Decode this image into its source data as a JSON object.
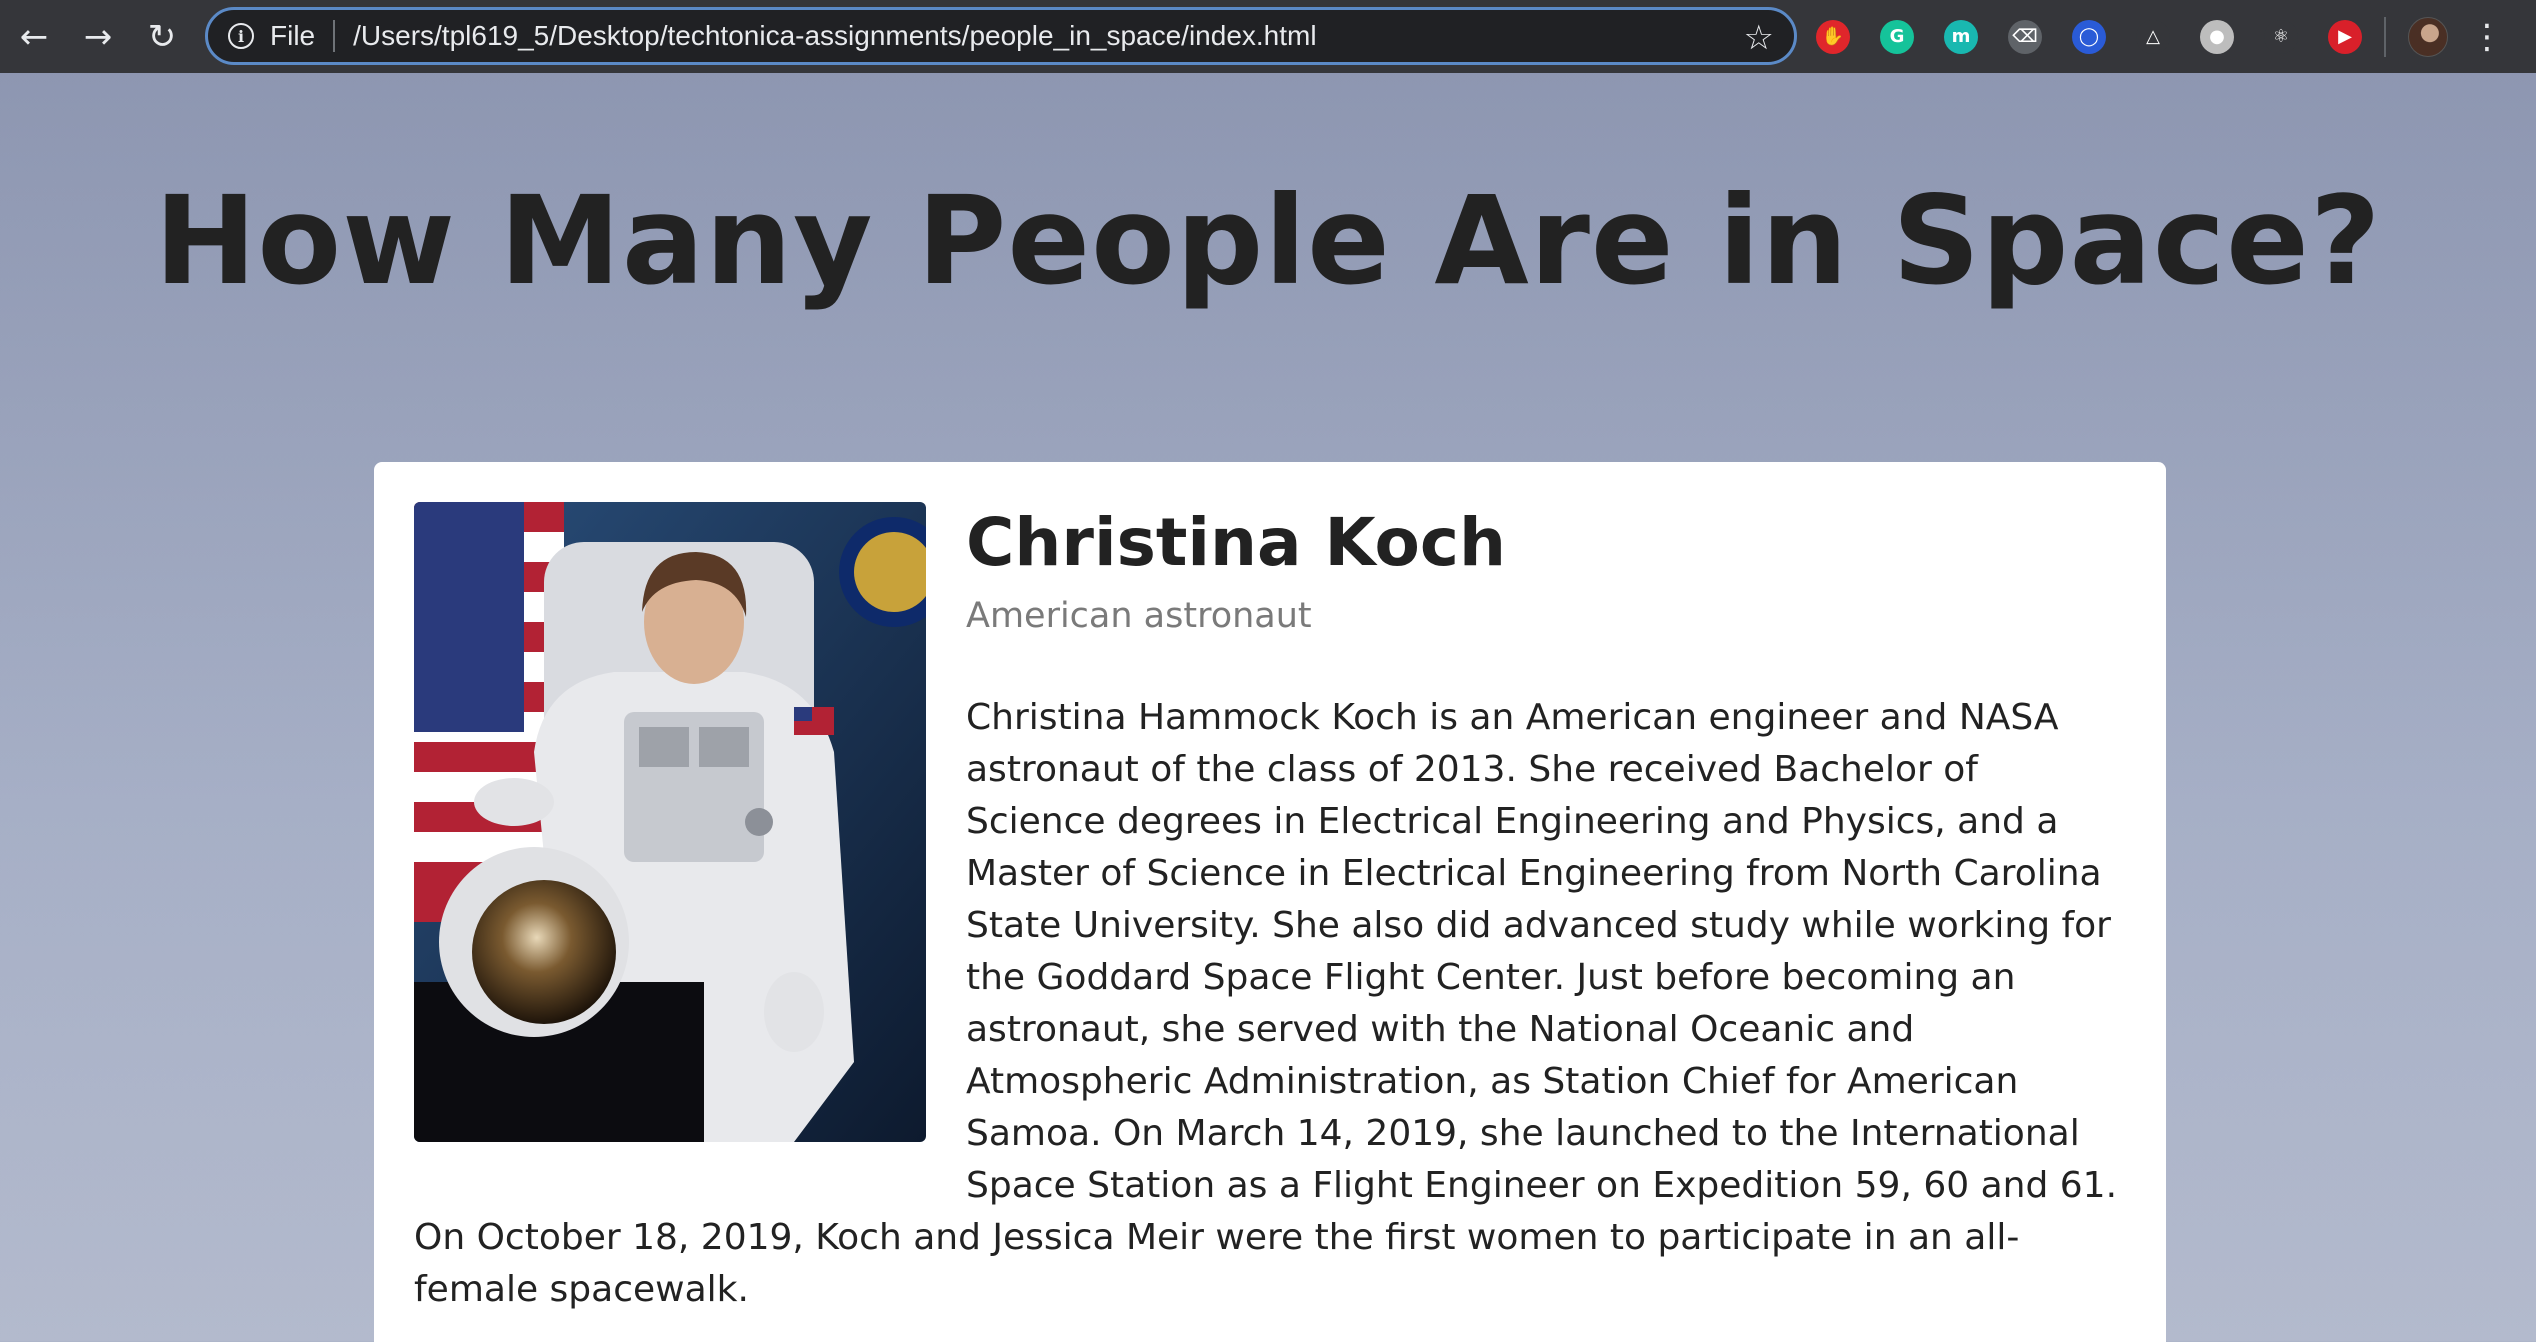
{
  "browser": {
    "file_label": "File",
    "url": "/Users/tpl619_5/Desktop/techtonica-assignments/people_in_space/index.html",
    "extensions": [
      {
        "name": "adblock-icon",
        "color": "#e0262b",
        "glyph": "✋"
      },
      {
        "name": "grammarly-icon",
        "color": "#15c39a",
        "glyph": "G"
      },
      {
        "name": "m-extension-icon",
        "color": "#19b8b0",
        "glyph": "m"
      },
      {
        "name": "clear-icon",
        "color": "#5f6368",
        "glyph": "⌫"
      },
      {
        "name": "ring-extension-icon",
        "color": "#2a5bd7",
        "glyph": "◯"
      },
      {
        "name": "triangle-extension-icon",
        "color": "#35363a",
        "glyph": "△"
      },
      {
        "name": "circle-extension-icon",
        "color": "#bdbdbd",
        "glyph": "●"
      },
      {
        "name": "react-devtools-icon",
        "color": "#35363a",
        "glyph": "⚛"
      },
      {
        "name": "youtube-extension-icon",
        "color": "#d9202a",
        "glyph": "▶"
      }
    ]
  },
  "page": {
    "title": "How Many People Are in Space?"
  },
  "astronaut": {
    "name": "Christina Koch",
    "role": "American astronaut",
    "bio": "Christina Hammock Koch is an American engineer and NASA astronaut of the class of 2013. She received Bachelor of Science degrees in Electrical Engineering and Physics, and a Master of Science in Electrical Engineering from North Carolina State University. She also did advanced study while working for the Goddard Space Flight Center. Just before becoming an astronaut, she served with the National Oceanic and Atmospheric Administration, as Station Chief for American Samoa. On March 14, 2019, she launched to the International Space Station as a Flight Engineer on Expedition 59, 60 and 61. On October 18, 2019, Koch and Jessica Meir were the first women to participate in an all-female spacewalk."
  }
}
